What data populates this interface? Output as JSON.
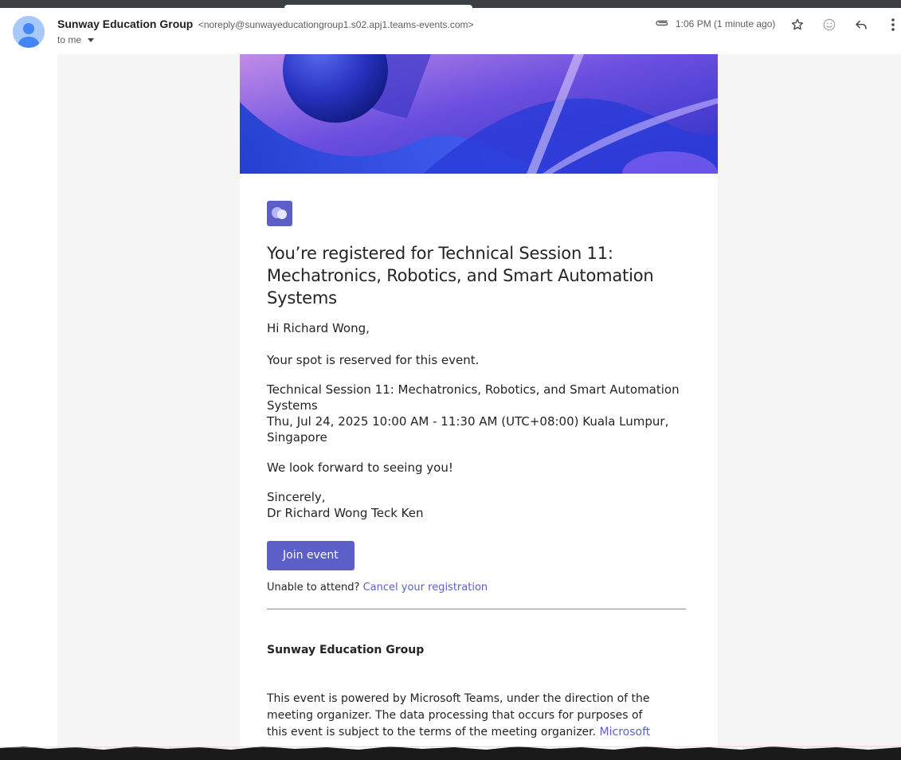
{
  "header": {
    "sender_name": "Sunway Education Group",
    "sender_email": "<noreply@sunwayeducationgroup1.s02.apj1.teams-events.com>",
    "to_label": "to me",
    "time": "1:06 PM (1 minute ago)",
    "icons": [
      "attachment-icon",
      "star-icon",
      "emoji-icon",
      "reply-icon",
      "more-vert-icon"
    ]
  },
  "email": {
    "title": "You’re registered for Technical Session 11: Mechatronics, Robotics, and Smart Automation Systems",
    "greeting": "Hi Richard Wong,",
    "spot": "Your spot is reserved for this event.",
    "event_name": "Technical Session 11: Mechatronics, Robotics, and Smart Automation Systems",
    "event_time": "Thu, Jul 24, 2025 10:00 AM - 11:30 AM (UTC+08:00) Kuala Lumpur, Singapore",
    "look_forward": "We look forward to seeing you!",
    "sincerely": "Sincerely,",
    "signer": "Dr Richard Wong Teck Ken",
    "join_button": "Join event",
    "unable_text": "Unable to attend?",
    "cancel_link": "Cancel your registration",
    "org_name": "Sunway Education Group",
    "footer_text": "This event is powered by Microsoft Teams, under the direction of the meeting organizer. The data processing that occurs for purposes of this event is subject to the terms of the meeting organizer.",
    "footer_link": "Microsoft"
  },
  "colors": {
    "accent": "#5b5fc7",
    "avatar": "#a8c7fa",
    "avatar_figure": "#4285f4"
  }
}
